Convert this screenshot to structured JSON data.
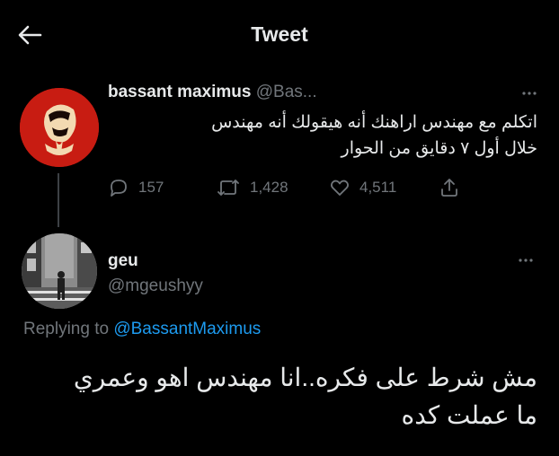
{
  "header": {
    "title": "Tweet",
    "back_icon": "arrow-left-icon"
  },
  "parent_tweet": {
    "display_name": "bassant maximus",
    "handle": "@Bas...",
    "text_line1": "اتكلم مع مهندس اراهنك أنه هيقولك أنه مهندس",
    "text_line2": "خلال أول ٧ دقايق من الحوار",
    "replies": "157",
    "retweets": "1,428",
    "likes": "4,511"
  },
  "reply_tweet": {
    "display_name": "geu",
    "handle": "@mgeushyy",
    "replying_prefix": "Replying to",
    "replying_to": "@BassantMaximus",
    "text_line1": "مش شرط على فكره..انا مهندس اهو وعمري",
    "text_line2": "ما عملت كده"
  },
  "colors": {
    "background": "#000000",
    "text": "#e7e9ea",
    "secondary": "#71767b",
    "accent": "#1d9bf0",
    "avatar_red": "#c81c12"
  }
}
